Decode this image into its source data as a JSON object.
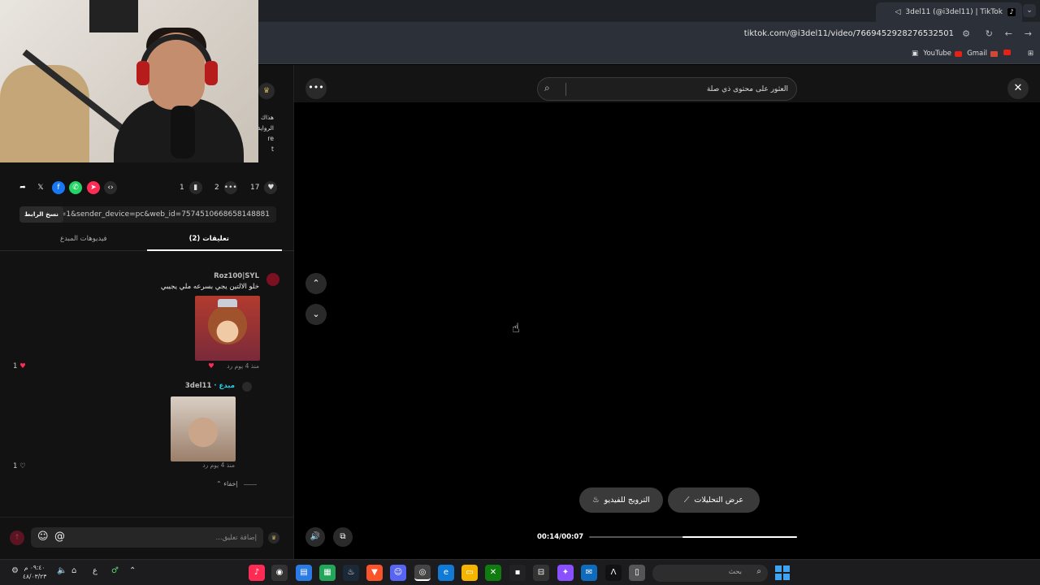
{
  "browser": {
    "tab_title": "3del11 (@i3del11) | TikTok",
    "url": "tiktok.com/@i3del11/video/7669452928276532501",
    "bookmarks": [
      "YouTube",
      "Gmail"
    ]
  },
  "sidebar": {
    "desc_lines": [
      "هذاك شا",
      "الرواية",
      "re",
      "t"
    ],
    "stats": {
      "likes": "17",
      "comments": "2",
      "saves": "1"
    },
    "link_text": "..._p=1&sender_device=pc&web_id=7574510668658148881",
    "copy_link_label": "نسخ الرابط",
    "tabs": {
      "comments": "(2) تعليقات",
      "creator_videos": "فيديوهات المبدع"
    },
    "comments": [
      {
        "username": "Roz100|SYL",
        "text": "خلو الالتين يجي بسرعه ملي يجيبي",
        "meta": "منذ 4 يوم   رد",
        "likes": "1"
      },
      {
        "username": "3del11",
        "badge": "مبدع",
        "meta": "منذ 4 يوم   رد",
        "likes": "1"
      }
    ],
    "hide_label": "إخفاء",
    "input_placeholder": "إضافة تعليق..."
  },
  "video": {
    "search_placeholder": "العثور على محتوى ذي صلة",
    "promote_label": "الترويج للفيديو",
    "analytics_label": "عرض التحليلات",
    "time": "00:14/00:07",
    "progress": 0.55
  },
  "taskbar": {
    "search_label": "بحث",
    "clock_time": "٠٩:٤٠ م",
    "clock_date": "٤٨/٠٣/٢٣",
    "lang": "ع"
  },
  "colors": {
    "accent": "#fe2c55",
    "panel": "#121212",
    "pill": "#3a3a3a"
  }
}
